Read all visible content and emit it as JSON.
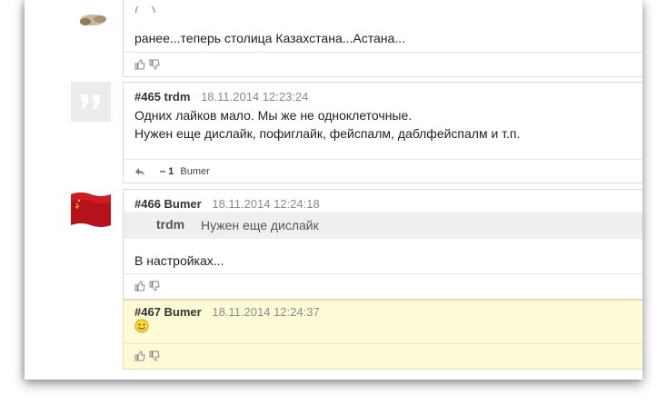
{
  "posts": [
    {
      "body_lines": [
        "ранее...теперь столица Казахстана...Астана..."
      ],
      "top_partial": "(…) …"
    },
    {
      "number": "#465",
      "author": "trdm",
      "date": "18.11.2014 12:23:24",
      "body_lines": [
        "Одних лайков мало. Мы же не одноклеточные.",
        "Нужен еще дислайк, пофиглайк, фейспалм, даблфейспалм и т.п."
      ],
      "vote_count": "‒ 1",
      "vote_user": "Bumer"
    },
    {
      "number": "#466",
      "author": "Bumer",
      "date": "18.11.2014 12:24:18",
      "quote_author": "trdm",
      "quote_text": "Нужен еще дислайк",
      "body_lines": [
        "В настройках..."
      ]
    },
    {
      "number": "#467",
      "author": "Bumer",
      "date": "18.11.2014 12:24:37",
      "emoji": "🙂"
    }
  ],
  "colors": {
    "highlight_bg": "#fdfbd5",
    "quote_bg": "#efefef",
    "border": "#d9d9d9"
  }
}
